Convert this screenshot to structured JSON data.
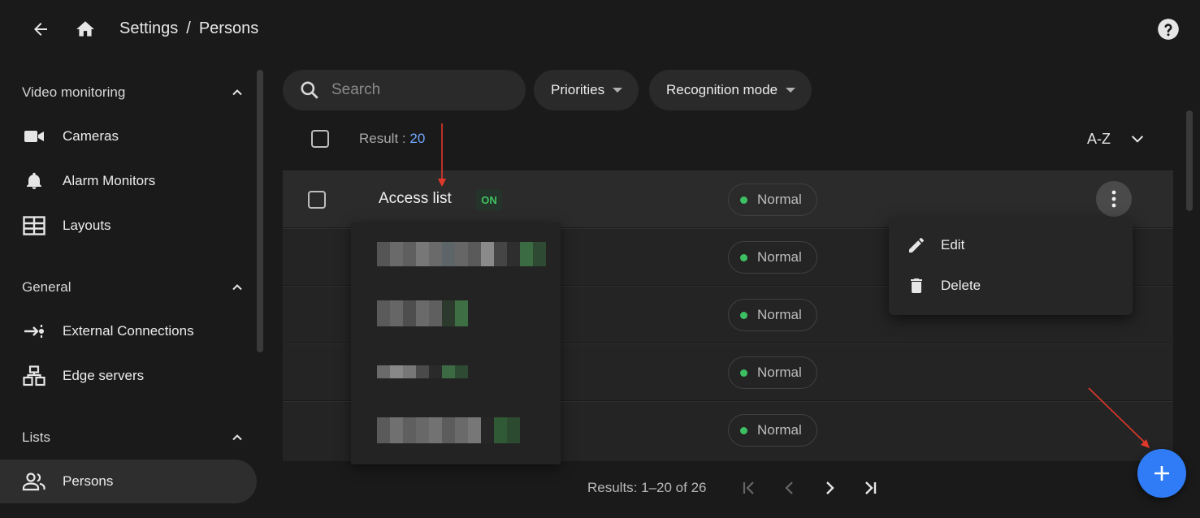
{
  "header": {
    "breadcrumb": [
      "Settings",
      "/",
      "Persons"
    ]
  },
  "sidebar": {
    "sections": [
      {
        "title": "Video monitoring",
        "items": [
          "Cameras",
          "Alarm Monitors",
          "Layouts"
        ]
      },
      {
        "title": "General",
        "items": [
          "External Connections",
          "Edge servers"
        ]
      },
      {
        "title": "Lists",
        "items": [
          "Persons"
        ]
      }
    ],
    "active_item": "Persons"
  },
  "filters": {
    "search_placeholder": "Search",
    "chips": [
      "Priorities",
      "Recognition mode"
    ]
  },
  "results": {
    "label": "Result : ",
    "count": "20",
    "sort": "A-Z"
  },
  "rows": [
    {
      "name": "Access list",
      "badge": "ON",
      "status": "Normal"
    },
    {
      "name": "",
      "status": "Normal"
    },
    {
      "name": "",
      "status": "Normal"
    },
    {
      "name": "",
      "status": "Normal"
    },
    {
      "name": "",
      "status": "Normal"
    }
  ],
  "context_menu": {
    "items": [
      "Edit",
      "Delete"
    ]
  },
  "pagination": {
    "text": "Results: 1–20 of 26"
  },
  "colors": {
    "accent": "#2f7cf6",
    "status_ok": "#3cc063",
    "annotation_arrow": "#e0392b"
  }
}
